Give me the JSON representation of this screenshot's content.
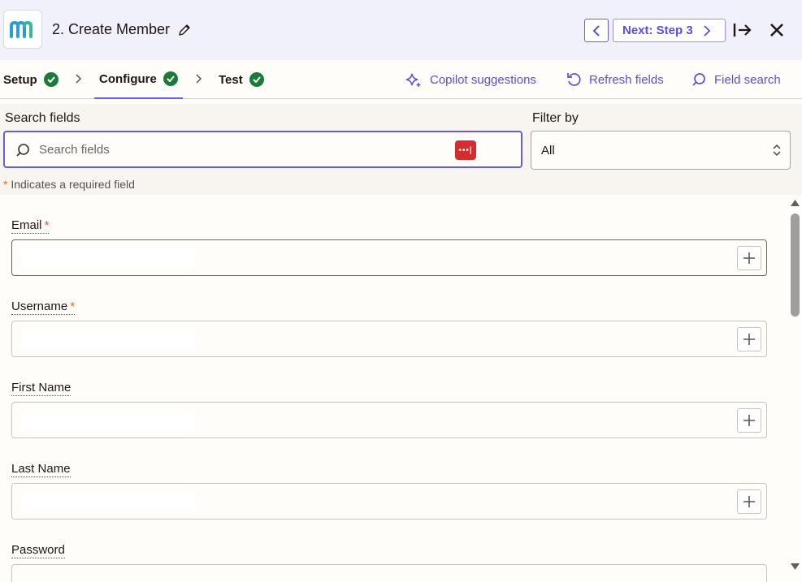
{
  "header": {
    "step_title": "2. Create Member",
    "next_label": "Next: Step 3"
  },
  "tabs": [
    {
      "label": "Setup",
      "complete": true
    },
    {
      "label": "Configure",
      "complete": true
    },
    {
      "label": "Test",
      "complete": true
    }
  ],
  "actions": {
    "copilot_label": "Copilot suggestions",
    "refresh_label": "Refresh fields",
    "field_search_label": "Field search"
  },
  "search": {
    "label": "Search fields",
    "placeholder": "Search fields"
  },
  "filter": {
    "label": "Filter by",
    "value": "All"
  },
  "required_note": {
    "star": "*",
    "text": "Indicates a required field"
  },
  "fields": [
    {
      "label": "Email",
      "required": "*"
    },
    {
      "label": "Username",
      "required": "*"
    },
    {
      "label": "First Name",
      "required": ""
    },
    {
      "label": "Last Name",
      "required": ""
    },
    {
      "label": "Password",
      "required": ""
    }
  ],
  "colors": {
    "accent": "#695be8",
    "success": "#1a7a37",
    "required": "#e5662a",
    "password_manager": "#d32d2f"
  }
}
